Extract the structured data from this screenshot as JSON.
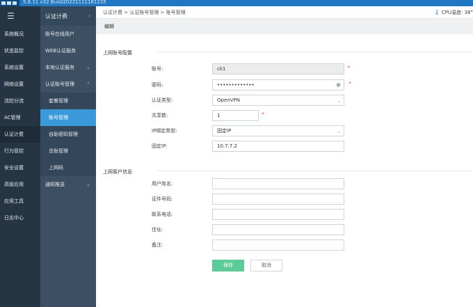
{
  "topbar": {
    "version": "5.8.11 x32 Build20221111181235"
  },
  "nav1": {
    "items": [
      "系统概况",
      "状态监控",
      "系统设置",
      "网络设置",
      "流控分流",
      "AC管理",
      "认证计费",
      "行为管控",
      "安全设置",
      "高级应用",
      "应用工具",
      "日志中心"
    ],
    "active_index": 6
  },
  "nav2": {
    "title": "认证计费",
    "items": [
      "账号在线用户",
      "WEB认证服务",
      "本地认证服务",
      "认证账号管理",
      "套餐管理",
      "账号管理",
      "自助密码管理",
      "总账管理",
      "上网码",
      "通知推送"
    ]
  },
  "breadcrumb": "认证计费 > 认证账号管理 > 账号管理",
  "cpu_label": "CPU温度: 38°",
  "edit_title": "编辑",
  "section1": "上网账号配置",
  "section2": "上网客户信息",
  "form": {
    "account_label": "账号:",
    "account_value": "ck1",
    "password_label": "密码:",
    "password_value": "•••••••••••••",
    "auth_type_label": "认证类型:",
    "auth_type_value": "OpenVPN",
    "share_label": "共享数:",
    "share_value": "1",
    "ip_bind_label": "IP绑定类型:",
    "ip_bind_value": "固定IP",
    "fixed_ip_label": "固定IP:",
    "fixed_ip_value": "10.7.7.2",
    "name_label": "用户姓名:",
    "id_label": "证件号码:",
    "phone_label": "联系电话:",
    "address_label": "住址:",
    "note_label": "备注:"
  },
  "buttons": {
    "save": "保存",
    "cancel": "取消"
  },
  "colors": {
    "topbar": "#1f78c1",
    "nav1": "#263543",
    "nav2": "#3c4f63",
    "active": "#3a99d9",
    "save": "#5ccb98",
    "required": "#e25555"
  }
}
